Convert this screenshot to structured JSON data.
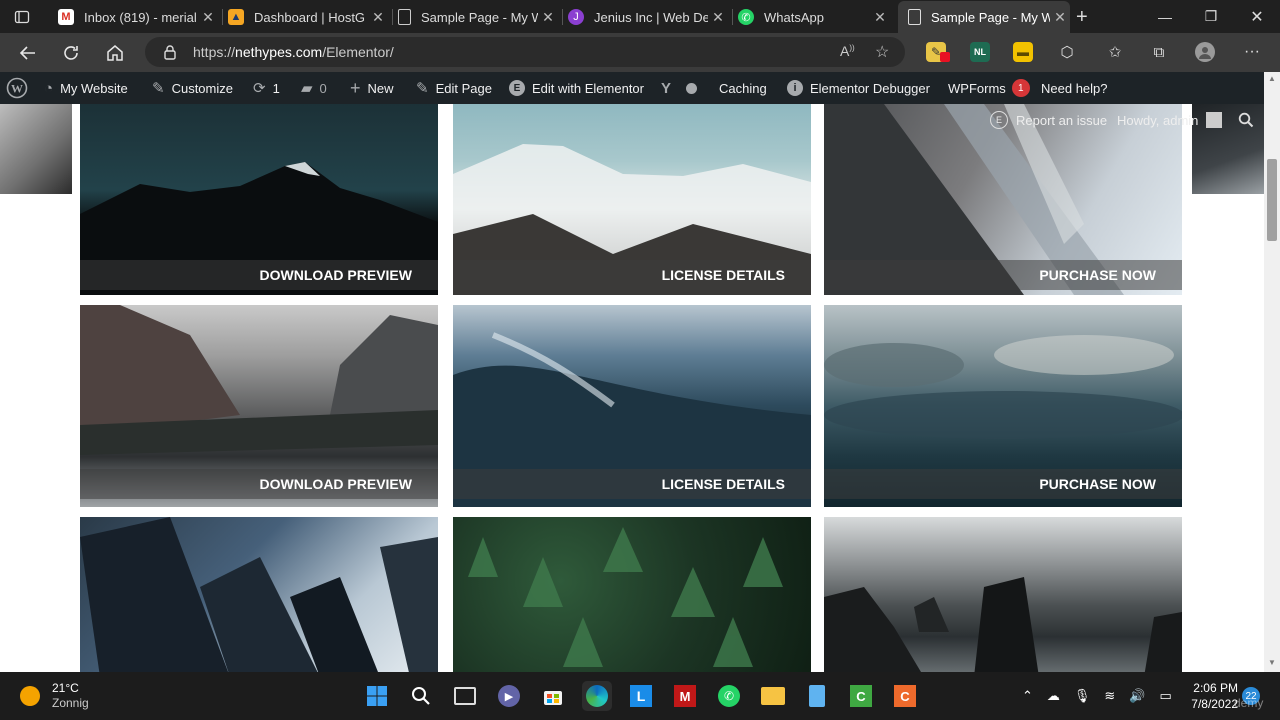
{
  "browser": {
    "tabs": [
      {
        "title": "Inbox (819) - merial",
        "icon": "gmail-icon"
      },
      {
        "title": "Dashboard | HostG",
        "icon": "hostgator-icon"
      },
      {
        "title": "Sample Page - My W",
        "icon": "page-icon"
      },
      {
        "title": "Jenius Inc | Web De",
        "icon": "jenius-icon"
      },
      {
        "title": "WhatsApp",
        "icon": "whatsapp-icon"
      },
      {
        "title": "Sample Page - My W",
        "icon": "page-icon",
        "active": true
      }
    ],
    "url_prefix": "https://",
    "url_domain": "nethypes.com",
    "url_path": "/Elementor/",
    "new_tab_symbol": "+",
    "extension_badge": "NL"
  },
  "adminbar": {
    "site_name": "My Website",
    "customize": "Customize",
    "updates_count": "1",
    "comments_count": "0",
    "new": "New",
    "edit_page": "Edit Page",
    "edit_elementor": "Edit with Elementor",
    "caching": "Caching",
    "debugger": "Elementor Debugger",
    "wpforms": "WPForms",
    "wpforms_count": "1",
    "help": "Need help?",
    "report_issue": "Report an issue",
    "howdy": "Howdy, admin"
  },
  "gallery": {
    "row1": [
      "DOWNLOAD PREVIEW",
      "LICENSE DETAILS",
      "PURCHASE NOW"
    ],
    "row2": [
      "DOWNLOAD PREVIEW",
      "LICENSE DETAILS",
      "PURCHASE NOW"
    ]
  },
  "taskbar": {
    "temperature": "21°C",
    "weather": "Zonnig",
    "time": "2:06 PM",
    "date": "7/8/2022",
    "notifications": "22",
    "watermark": "demy"
  },
  "colors": {
    "adminbar_bg": "#1d2327",
    "badge_red": "#d63638",
    "browser_dark": "#202020"
  }
}
